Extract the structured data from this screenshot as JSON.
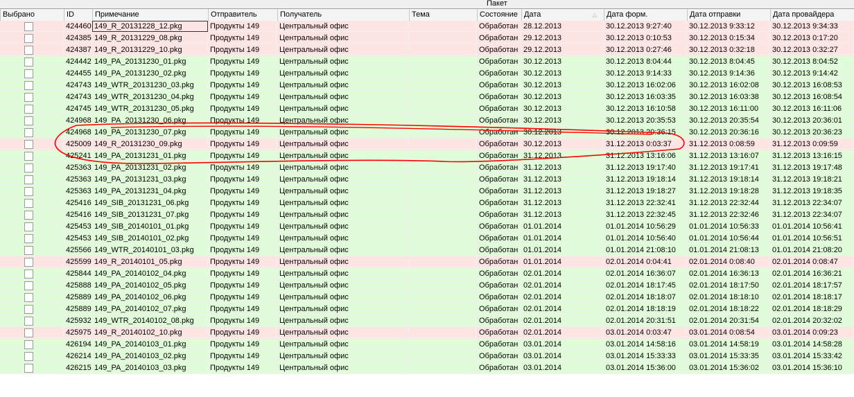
{
  "group_header": "Пакет",
  "columns": [
    "Выбрано",
    "ID",
    "Примечание",
    "Отправитель",
    "Получатель",
    "Тема",
    "Состояние",
    "Дата",
    "Дата форм.",
    "Дата отправки",
    "Дата провайдера"
  ],
  "colors": {
    "error_row": "#ffe4e4",
    "ok_row": "#e0fcd8",
    "annotation": "#ff0000"
  },
  "rows": [
    {
      "id": "424460",
      "note": "149_R_20131228_12.pkg",
      "sender": "Продукты 149",
      "recipient": "Центральный офис",
      "subject": "",
      "status": "Обработан",
      "date": "28.12.2013",
      "formed": "30.12.2013 9:27:40",
      "sent": "30.12.2013 9:33:12",
      "provider": "30.12.2013 9:34:33",
      "highlight": "red",
      "checked": false
    },
    {
      "id": "424385",
      "note": "149_R_20131229_08.pkg",
      "sender": "Продукты 149",
      "recipient": "Центральный офис",
      "subject": "",
      "status": "Обработан",
      "date": "29.12.2013",
      "formed": "30.12.2013 0:10:53",
      "sent": "30.12.2013 0:15:34",
      "provider": "30.12.2013 0:17:20",
      "highlight": "red",
      "checked": false
    },
    {
      "id": "424387",
      "note": "149_R_20131229_10.pkg",
      "sender": "Продукты 149",
      "recipient": "Центральный офис",
      "subject": "",
      "status": "Обработан",
      "date": "29.12.2013",
      "formed": "30.12.2013 0:27:46",
      "sent": "30.12.2013 0:32:18",
      "provider": "30.12.2013 0:32:27",
      "highlight": "red",
      "checked": false
    },
    {
      "id": "424442",
      "note": "149_PA_20131230_01.pkg",
      "sender": "Продукты 149",
      "recipient": "Центральный офис",
      "subject": "",
      "status": "Обработан",
      "date": "30.12.2013",
      "formed": "30.12.2013 8:04:44",
      "sent": "30.12.2013 8:04:45",
      "provider": "30.12.2013 8:04:52",
      "highlight": "green",
      "checked": false
    },
    {
      "id": "424455",
      "note": "149_PA_20131230_02.pkg",
      "sender": "Продукты 149",
      "recipient": "Центральный офис",
      "subject": "",
      "status": "Обработан",
      "date": "30.12.2013",
      "formed": "30.12.2013 9:14:33",
      "sent": "30.12.2013 9:14:36",
      "provider": "30.12.2013 9:14:42",
      "highlight": "green",
      "checked": false
    },
    {
      "id": "424743",
      "note": "149_WTR_20131230_03.pkg",
      "sender": "Продукты 149",
      "recipient": "Центральный офис",
      "subject": "",
      "status": "Обработан",
      "date": "30.12.2013",
      "formed": "30.12.2013 16:02:06",
      "sent": "30.12.2013 16:02:08",
      "provider": "30.12.2013 16:08:53",
      "highlight": "green",
      "checked": false
    },
    {
      "id": "424743",
      "note": "149_WTR_20131230_04.pkg",
      "sender": "Продукты 149",
      "recipient": "Центральный офис",
      "subject": "",
      "status": "Обработан",
      "date": "30.12.2013",
      "formed": "30.12.2013 16:03:35",
      "sent": "30.12.2013 16:03:38",
      "provider": "30.12.2013 16:08:54",
      "highlight": "green",
      "checked": false
    },
    {
      "id": "424745",
      "note": "149_WTR_20131230_05.pkg",
      "sender": "Продукты 149",
      "recipient": "Центральный офис",
      "subject": "",
      "status": "Обработан",
      "date": "30.12.2013",
      "formed": "30.12.2013 16:10:58",
      "sent": "30.12.2013 16:11:00",
      "provider": "30.12.2013 16:11:06",
      "highlight": "green",
      "checked": false
    },
    {
      "id": "424968",
      "note": "149_PA_20131230_06.pkg",
      "sender": "Продукты 149",
      "recipient": "Центральный офис",
      "subject": "",
      "status": "Обработан",
      "date": "30.12.2013",
      "formed": "30.12.2013 20:35:53",
      "sent": "30.12.2013 20:35:54",
      "provider": "30.12.2013 20:36:01",
      "highlight": "green",
      "checked": false
    },
    {
      "id": "424968",
      "note": "149_PA_20131230_07.pkg",
      "sender": "Продукты 149",
      "recipient": "Центральный офис",
      "subject": "",
      "status": "Обработан",
      "date": "30.12.2013",
      "formed": "30.12.2013 20:36:15",
      "sent": "30.12.2013 20:36:16",
      "provider": "30.12.2013 20:36:23",
      "highlight": "green",
      "checked": false
    },
    {
      "id": "425009",
      "note": "149_R_20131230_09.pkg",
      "sender": "Продукты 149",
      "recipient": "Центральный офис",
      "subject": "",
      "status": "Обработан",
      "date": "30.12.2013",
      "formed": "31.12.2013 0:03:37",
      "sent": "31.12.2013 0:08:59",
      "provider": "31.12.2013 0:09:59",
      "highlight": "red",
      "checked": false
    },
    {
      "id": "425241",
      "note": "149_PA_20131231_01.pkg",
      "sender": "Продукты 149",
      "recipient": "Центральный офис",
      "subject": "",
      "status": "Обработан",
      "date": "31.12.2013",
      "formed": "31.12.2013 13:16:06",
      "sent": "31.12.2013 13:16:07",
      "provider": "31.12.2013 13:16:15",
      "highlight": "green",
      "checked": false
    },
    {
      "id": "425363",
      "note": "149_PA_20131231_02.pkg",
      "sender": "Продукты 149",
      "recipient": "Центральный офис",
      "subject": "",
      "status": "Обработан",
      "date": "31.12.2013",
      "formed": "31.12.2013 19:17:40",
      "sent": "31.12.2013 19:17:41",
      "provider": "31.12.2013 19:17:48",
      "highlight": "green",
      "checked": false
    },
    {
      "id": "425363",
      "note": "149_PA_20131231_03.pkg",
      "sender": "Продукты 149",
      "recipient": "Центральный офис",
      "subject": "",
      "status": "Обработан",
      "date": "31.12.2013",
      "formed": "31.12.2013 19:18:14",
      "sent": "31.12.2013 19:18:14",
      "provider": "31.12.2013 19:18:21",
      "highlight": "green",
      "checked": false
    },
    {
      "id": "425363",
      "note": "149_PA_20131231_04.pkg",
      "sender": "Продукты 149",
      "recipient": "Центральный офис",
      "subject": "",
      "status": "Обработан",
      "date": "31.12.2013",
      "formed": "31.12.2013 19:18:27",
      "sent": "31.12.2013 19:18:28",
      "provider": "31.12.2013 19:18:35",
      "highlight": "green",
      "checked": false
    },
    {
      "id": "425416",
      "note": "149_SIB_20131231_06.pkg",
      "sender": "Продукты 149",
      "recipient": "Центральный офис",
      "subject": "",
      "status": "Обработан",
      "date": "31.12.2013",
      "formed": "31.12.2013 22:32:41",
      "sent": "31.12.2013 22:32:44",
      "provider": "31.12.2013 22:34:07",
      "highlight": "green",
      "checked": false
    },
    {
      "id": "425416",
      "note": "149_SIB_20131231_07.pkg",
      "sender": "Продукты 149",
      "recipient": "Центральный офис",
      "subject": "",
      "status": "Обработан",
      "date": "31.12.2013",
      "formed": "31.12.2013 22:32:45",
      "sent": "31.12.2013 22:32:46",
      "provider": "31.12.2013 22:34:07",
      "highlight": "green",
      "checked": false
    },
    {
      "id": "425453",
      "note": "149_SIB_20140101_01.pkg",
      "sender": "Продукты 149",
      "recipient": "Центральный офис",
      "subject": "",
      "status": "Обработан",
      "date": "01.01.2014",
      "formed": "01.01.2014 10:56:29",
      "sent": "01.01.2014 10:56:33",
      "provider": "01.01.2014 10:56:41",
      "highlight": "green",
      "checked": false
    },
    {
      "id": "425453",
      "note": "149_SIB_20140101_02.pkg",
      "sender": "Продукты 149",
      "recipient": "Центральный офис",
      "subject": "",
      "status": "Обработан",
      "date": "01.01.2014",
      "formed": "01.01.2014 10:56:40",
      "sent": "01.01.2014 10:56:44",
      "provider": "01.01.2014 10:56:51",
      "highlight": "green",
      "checked": false
    },
    {
      "id": "425566",
      "note": "149_WTR_20140101_03.pkg",
      "sender": "Продукты 149",
      "recipient": "Центральный офис",
      "subject": "",
      "status": "Обработан",
      "date": "01.01.2014",
      "formed": "01.01.2014 21:08:10",
      "sent": "01.01.2014 21:08:13",
      "provider": "01.01.2014 21:08:20",
      "highlight": "green",
      "checked": false
    },
    {
      "id": "425599",
      "note": "149_R_20140101_05.pkg",
      "sender": "Продукты 149",
      "recipient": "Центральный офис",
      "subject": "",
      "status": "Обработан",
      "date": "01.01.2014",
      "formed": "02.01.2014 0:04:41",
      "sent": "02.01.2014 0:08:40",
      "provider": "02.01.2014 0:08:47",
      "highlight": "red",
      "checked": false
    },
    {
      "id": "425844",
      "note": "149_PA_20140102_04.pkg",
      "sender": "Продукты 149",
      "recipient": "Центральный офис",
      "subject": "",
      "status": "Обработан",
      "date": "02.01.2014",
      "formed": "02.01.2014 16:36:07",
      "sent": "02.01.2014 16:36:13",
      "provider": "02.01.2014 16:36:21",
      "highlight": "green",
      "checked": false
    },
    {
      "id": "425888",
      "note": "149_PA_20140102_05.pkg",
      "sender": "Продукты 149",
      "recipient": "Центральный офис",
      "subject": "",
      "status": "Обработан",
      "date": "02.01.2014",
      "formed": "02.01.2014 18:17:45",
      "sent": "02.01.2014 18:17:50",
      "provider": "02.01.2014 18:17:57",
      "highlight": "green",
      "checked": false
    },
    {
      "id": "425889",
      "note": "149_PA_20140102_06.pkg",
      "sender": "Продукты 149",
      "recipient": "Центральный офис",
      "subject": "",
      "status": "Обработан",
      "date": "02.01.2014",
      "formed": "02.01.2014 18:18:07",
      "sent": "02.01.2014 18:18:10",
      "provider": "02.01.2014 18:18:17",
      "highlight": "green",
      "checked": false
    },
    {
      "id": "425889",
      "note": "149_PA_20140102_07.pkg",
      "sender": "Продукты 149",
      "recipient": "Центральный офис",
      "subject": "",
      "status": "Обработан",
      "date": "02.01.2014",
      "formed": "02.01.2014 18:18:19",
      "sent": "02.01.2014 18:18:22",
      "provider": "02.01.2014 18:18:29",
      "highlight": "green",
      "checked": false
    },
    {
      "id": "425932",
      "note": "149_WTR_20140102_08.pkg",
      "sender": "Продукты 149",
      "recipient": "Центральный офис",
      "subject": "",
      "status": "Обработан",
      "date": "02.01.2014",
      "formed": "02.01.2014 20:31:51",
      "sent": "02.01.2014 20:31:54",
      "provider": "02.01.2014 20:32:02",
      "highlight": "green",
      "checked": false
    },
    {
      "id": "425975",
      "note": "149_R_20140102_10.pkg",
      "sender": "Продукты 149",
      "recipient": "Центральный офис",
      "subject": "",
      "status": "Обработан",
      "date": "02.01.2014",
      "formed": "03.01.2014 0:03:47",
      "sent": "03.01.2014 0:08:54",
      "provider": "03.01.2014 0:09:23",
      "highlight": "red",
      "checked": false
    },
    {
      "id": "426194",
      "note": "149_PA_20140103_01.pkg",
      "sender": "Продукты 149",
      "recipient": "Центральный офис",
      "subject": "",
      "status": "Обработан",
      "date": "03.01.2014",
      "formed": "03.01.2014 14:58:16",
      "sent": "03.01.2014 14:58:19",
      "provider": "03.01.2014 14:58:28",
      "highlight": "green",
      "checked": false
    },
    {
      "id": "426214",
      "note": "149_PA_20140103_02.pkg",
      "sender": "Продукты 149",
      "recipient": "Центральный офис",
      "subject": "",
      "status": "Обработан",
      "date": "03.01.2014",
      "formed": "03.01.2014 15:33:33",
      "sent": "03.01.2014 15:33:35",
      "provider": "03.01.2014 15:33:42",
      "highlight": "green",
      "checked": false
    },
    {
      "id": "426215",
      "note": "149_PA_20140103_03.pkg",
      "sender": "Продукты 149",
      "recipient": "Центральный офис",
      "subject": "",
      "status": "Обработан",
      "date": "03.01.2014",
      "formed": "03.01.2014 15:36:00",
      "sent": "03.01.2014 15:36:02",
      "provider": "03.01.2014 15:36:10",
      "highlight": "green",
      "checked": false
    }
  ]
}
